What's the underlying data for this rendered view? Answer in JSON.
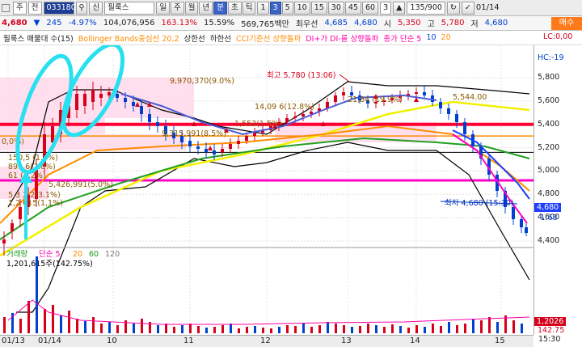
{
  "toolbar": {
    "menu1": "주",
    "menu2": "전",
    "code": "033180",
    "lock_label": "신",
    "stock_name": "필룩스",
    "periods": [
      "일",
      "주",
      "월",
      "년",
      "분",
      "초",
      "틱"
    ],
    "selected_period": "분",
    "intervals": [
      "1",
      "3",
      "5",
      "10",
      "15",
      "30",
      "45",
      "60"
    ],
    "selected_interval": "3",
    "interval_value": "3",
    "count": "135/900",
    "date": "01/14"
  },
  "quote": {
    "price": "4,680",
    "change": "245",
    "change_pct": "-4.97%",
    "volume": "104,076,956",
    "turnover_pct": "163.13%",
    "ratio": "15.59%",
    "amount": "569,765백만",
    "min_label": "최우선",
    "bid_price": "4,685",
    "ask_price": "4,680",
    "open_label": "시",
    "open": "5,350",
    "high_label": "고",
    "high": "5,780",
    "low_label": "저",
    "low": "4,680",
    "order_button": "매수"
  },
  "indicators": {
    "ma_label": "필룩스 매물대 수(15)",
    "bb_label": "Bollinger Bands중심선 20,2",
    "bb_upper": "상한선",
    "bb_lower": "하한선",
    "cci_label": "CCI기준선 상향돌파",
    "di_label": "DI+가 DI-를 상향돌파",
    "sma_label": "종가 단순 5",
    "sma_10": "10",
    "sma_20": "20",
    "right_top": "LC:0,00",
    "right_top2": "HC:-19"
  },
  "price_chart": {
    "annotations": {
      "high": "최고 5,780 (13:06)",
      "low": "최저 4,680 (15:30)",
      "a1": "9,970,370(9.0%)",
      "a2": "14,09 6(12.8%)",
      "a3": "9,315,991(8.5%)",
      "a4": "1,553(1.5%)",
      "a5": "21,84 (19.9%)",
      "a6": "5,544.00",
      "a7": "5,426,991(5.0%)",
      "a8": "5,3 2 2(3.1%)",
      "a9": "1,2 615(1,1%)",
      "a10": "150,5 (1.0%)",
      "a11": "891 6(2.6%)",
      "a12": "61 (1,2%)",
      "a13": "0,0%)"
    },
    "price_axis": [
      "5,800",
      "5,600",
      "5,400",
      "5,200",
      "5,000",
      "4,800",
      "4,600",
      "4,400"
    ],
    "last_price": "4,680",
    "last_change": "-1.68"
  },
  "volume_chart": {
    "label": "거래량",
    "sma_label": "단순 5",
    "sma_values": [
      "20",
      "60",
      "120"
    ],
    "info": "1,201,615주(142.75%)",
    "axis_top": "1,2026",
    "axis_pct": "142.75"
  },
  "dates": [
    "01/13",
    "01/14",
    "10",
    "11",
    "12",
    "13",
    "14",
    "15"
  ],
  "corner": "15:30",
  "colors": {
    "up": "#d6001c",
    "down": "#0040d0",
    "cyan": "#27e0f0",
    "magenta": "#ff00c8",
    "red_line": "#ff0033",
    "yellow": "#f2f000",
    "green": "#22a022",
    "orange": "#ff8c00"
  }
}
